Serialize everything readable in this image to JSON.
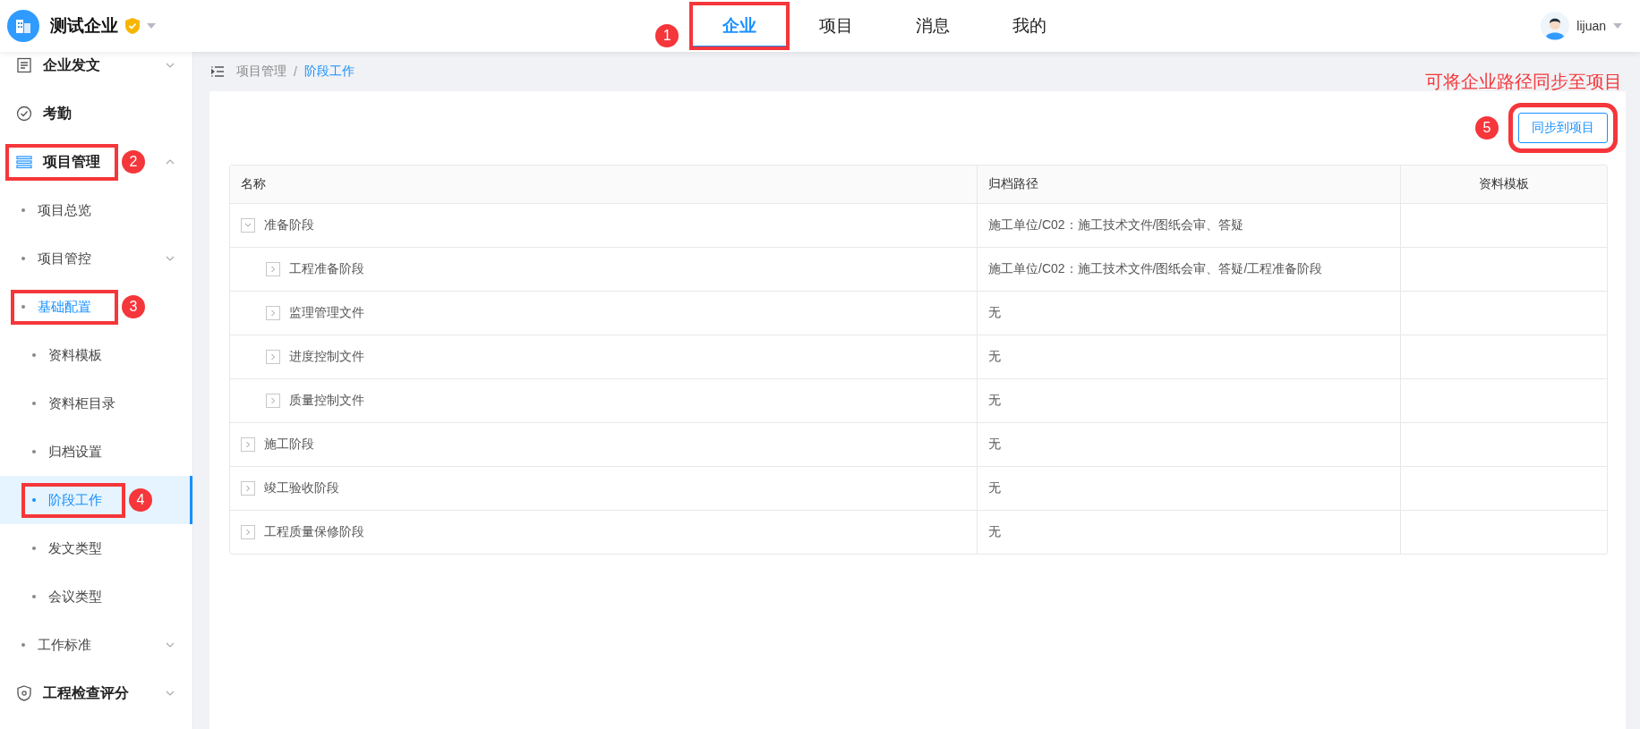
{
  "header": {
    "company": "测试企业",
    "verified": true,
    "user": "lijuan"
  },
  "nav_tabs": [
    {
      "label": "企业",
      "selected": true,
      "marker": "1"
    },
    {
      "label": "项目",
      "selected": false
    },
    {
      "label": "消息",
      "selected": false
    },
    {
      "label": "我的",
      "selected": false
    }
  ],
  "sidebar": {
    "items": [
      {
        "label": "企业发文",
        "expanded": false,
        "selected": false
      },
      {
        "label": "考勤",
        "selected": false
      },
      {
        "label": "项目管理",
        "expanded": true,
        "selected": false,
        "marker": "2",
        "children": [
          {
            "label": "项目总览",
            "selected": false
          },
          {
            "label": "项目管控",
            "expanded": false,
            "selected": false
          },
          {
            "label": "基础配置",
            "selected": false,
            "marker": "3",
            "children": [
              {
                "label": "资料模板",
                "selected": false
              },
              {
                "label": "资料柜目录",
                "selected": false
              },
              {
                "label": "归档设置",
                "selected": false
              },
              {
                "label": "阶段工作",
                "selected": true,
                "marker": "4"
              },
              {
                "label": "发文类型",
                "selected": false
              },
              {
                "label": "会议类型",
                "selected": false
              }
            ]
          },
          {
            "label": "工作标准",
            "expanded": false,
            "selected": false
          }
        ]
      },
      {
        "label": "工程检查评分",
        "expanded": false,
        "selected": false
      }
    ]
  },
  "breadcrumb": {
    "items": [
      "项目管理",
      "阶段工作"
    ],
    "separator": "/"
  },
  "note": "可将企业路径同步至项目",
  "sync_button": {
    "label": "同步到项目",
    "marker": "5"
  },
  "table": {
    "columns": [
      "名称",
      "归档路径",
      "资料模板"
    ],
    "rows": [
      {
        "name": "准备阶段",
        "path": "施工单位/C02：施工技术文件/图纸会审、答疑",
        "expanded": true,
        "children": [
          {
            "name": "工程准备阶段",
            "path": "施工单位/C02：施工技术文件/图纸会审、答疑/工程准备阶段",
            "expanded": false
          },
          {
            "name": "监理管理文件",
            "path": "无",
            "expanded": false
          },
          {
            "name": "进度控制文件",
            "path": "无",
            "expanded": false
          },
          {
            "name": "质量控制文件",
            "path": "无",
            "expanded": false
          }
        ]
      },
      {
        "name": "施工阶段",
        "path": "无",
        "expanded": false
      },
      {
        "name": "竣工验收阶段",
        "path": "无",
        "expanded": false
      },
      {
        "name": "工程质量保修阶段",
        "path": "无",
        "expanded": false
      }
    ]
  }
}
